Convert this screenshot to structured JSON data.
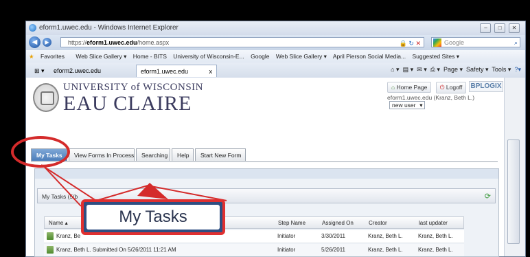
{
  "browser": {
    "title": "eform1.uwec.edu - Windows Internet Explorer",
    "address_prefix": "https://",
    "address_host": "eform1.uwec.edu",
    "address_path": "/home.aspx",
    "search_placeholder": "Google",
    "favorites_label": "Favorites",
    "favorites": [
      "Web Slice Gallery ▾",
      "Home - BITS",
      "University of Wisconsin-E...",
      "Google",
      "Web Slice Gallery ▾",
      "April Pierson Social Media...",
      "Suggested Sites ▾"
    ],
    "tabs": [
      "eform2.uwec.edu",
      "eform1.uwec.edu"
    ],
    "commands": [
      "Page ▾",
      "Safety ▾",
      "Tools ▾"
    ],
    "window_buttons": [
      "–",
      "□",
      "✕"
    ]
  },
  "site": {
    "university_line": "UNIVERSITY of WISCONSIN",
    "campus_line": "EAU CLAIRE",
    "home_page_label": "Home Page",
    "logoff_label": "Logoff",
    "brand": "BPLOGIX",
    "user_text": "eform1.uwec.edu (Kranz, Beth L.)",
    "user_select": "new user"
  },
  "app_tabs": [
    "My Tasks",
    "View Forms In Process",
    "Searching",
    "Help",
    "Start New Form"
  ],
  "panel": {
    "title": "My Tasks (5/b"
  },
  "grid": {
    "headers": [
      "Name ▴",
      "Step Name",
      "Assigned On",
      "Creator",
      "last updater"
    ],
    "rows": [
      [
        "Kranz, Be",
        "Initiator",
        "3/30/2011",
        "Kranz, Beth L.",
        "Kranz, Beth L."
      ],
      [
        "Kranz, Beth L. Submitted On 5/26/2011 11:21 AM",
        "Initiator",
        "5/26/2011",
        "Kranz, Beth L.",
        "Kranz, Beth L."
      ]
    ]
  },
  "callout": {
    "text": "My Tasks",
    "border_color": "#e03030"
  },
  "colors": {
    "accent_tab": "#4b7dba",
    "annotation_red": "#d42b2b"
  }
}
